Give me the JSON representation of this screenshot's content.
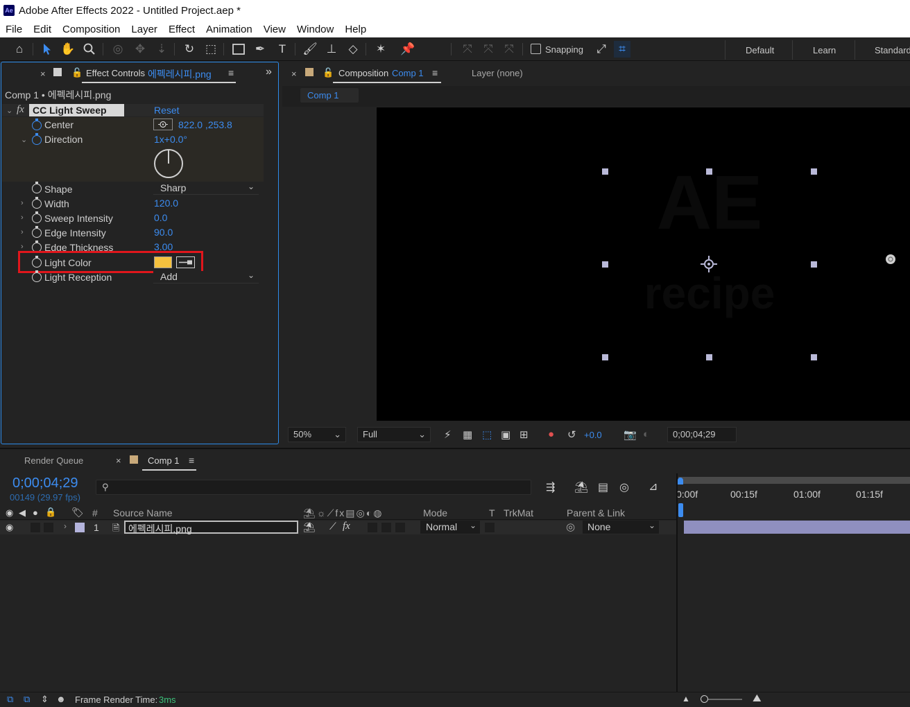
{
  "window": {
    "title": "Adobe After Effects 2022 - Untitled Project.aep *",
    "app_icon_text": "Ae"
  },
  "menu": [
    "File",
    "Edit",
    "Composition",
    "Layer",
    "Effect",
    "Animation",
    "View",
    "Window",
    "Help"
  ],
  "toolbar": {
    "snapping_label": "Snapping",
    "workspaces": [
      "Default",
      "Learn",
      "Standard"
    ]
  },
  "effect_controls": {
    "tab_prefix": "Effect Controls",
    "tab_file": "에펙레시피.png",
    "breadcrumb": "Comp 1 • 에펙레시피.png",
    "effect_name": "CC Light Sweep",
    "fx_label": "fx",
    "reset_label": "Reset",
    "properties": {
      "center": {
        "label": "Center",
        "value": "822.0 ,253.8"
      },
      "direction": {
        "label": "Direction",
        "value": "1x+0.0°"
      },
      "shape": {
        "label": "Shape",
        "value": "Sharp"
      },
      "width": {
        "label": "Width",
        "value": "120.0"
      },
      "sweep_intensity": {
        "label": "Sweep Intensity",
        "value": "0.0"
      },
      "edge_intensity": {
        "label": "Edge Intensity",
        "value": "90.0"
      },
      "edge_thickness": {
        "label": "Edge Thickness",
        "value": "3.00"
      },
      "light_color": {
        "label": "Light Color",
        "swatch": "#f5c13e"
      },
      "light_reception": {
        "label": "Light Reception",
        "value": "Add"
      }
    },
    "highlight_color": "#e0161c"
  },
  "composition": {
    "tab_prefix": "Composition",
    "tab_comp": "Comp 1",
    "layer_tab": "Layer (none)",
    "sub_tab": "Comp 1",
    "viewer_bg": "#000000"
  },
  "viewer_bar": {
    "zoom": "50%",
    "resolution": "Full",
    "exposure": "+0.0",
    "timecode": "0;00;04;29"
  },
  "timeline": {
    "tabs": {
      "render_queue": "Render Queue",
      "comp": "Comp 1"
    },
    "current_time": "0;00;04;29",
    "frame_info": "00149 (29.97 fps)",
    "columns": {
      "number": "#",
      "source_name": "Source Name",
      "mode": "Mode",
      "t": "T",
      "trkmat": "TrkMat",
      "parent_link": "Parent & Link"
    },
    "ruler": [
      "0:00f",
      "00:15f",
      "01:00f",
      "01:15f"
    ],
    "layer": {
      "index": "1",
      "name": "에펙레시피.png",
      "mode": "Normal",
      "parent": "None",
      "label_color": "#b4b4dc"
    }
  },
  "status": {
    "frame_render_label": "Frame Render Time:",
    "frame_render_value": "3ms"
  }
}
